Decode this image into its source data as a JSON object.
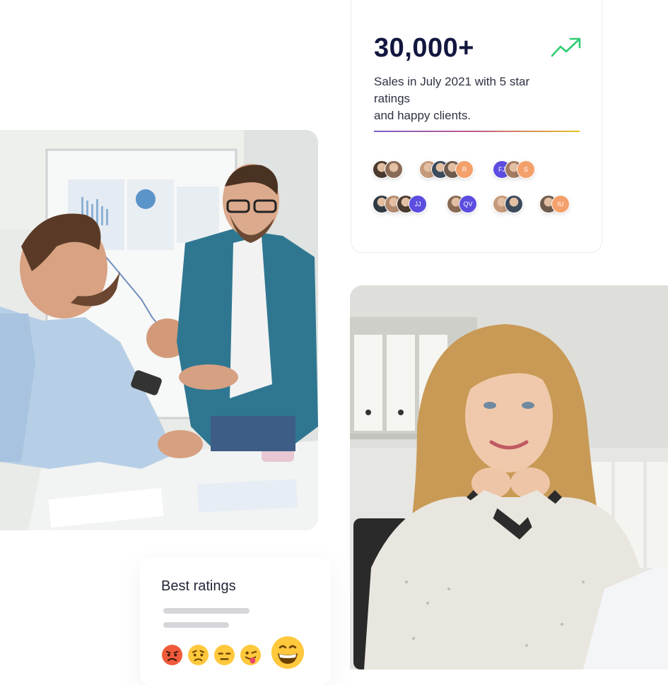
{
  "stats": {
    "value": "30,000+",
    "description_lines": [
      "Sales in July 2021 with 5 star",
      "ratings",
      "and happy clients."
    ],
    "trend_icon": "trending-up-icon",
    "accent_color": "#2ecc71"
  },
  "avatar_groups": [
    {
      "avatars": [
        {
          "type": "photo"
        },
        {
          "type": "photo"
        }
      ]
    },
    {
      "avatars": [
        {
          "type": "photo"
        },
        {
          "type": "photo"
        },
        {
          "type": "photo"
        },
        {
          "type": "initials",
          "text": "R",
          "color": "#f4a06b"
        }
      ]
    },
    {
      "avatars": [
        {
          "type": "initials",
          "text": "FJ",
          "color": "#5c4de0"
        },
        {
          "type": "photo"
        },
        {
          "type": "initials",
          "text": "S",
          "color": "#f4a06b"
        }
      ]
    },
    {
      "avatars": [
        {
          "type": "photo"
        },
        {
          "type": "photo"
        },
        {
          "type": "photo"
        },
        {
          "type": "initials",
          "text": "JJ",
          "color": "#5c4de0"
        }
      ]
    },
    {
      "avatars": [
        {
          "type": "photo"
        },
        {
          "type": "initials",
          "text": "QV",
          "color": "#5c4de0"
        }
      ]
    },
    {
      "avatars": [
        {
          "type": "photo"
        },
        {
          "type": "photo"
        }
      ]
    },
    {
      "avatars": [
        {
          "type": "photo"
        },
        {
          "type": "initials",
          "text": "IU",
          "color": "#f4a06b"
        }
      ]
    }
  ],
  "photos": {
    "team": {
      "subject": "two men talking at office desk"
    },
    "woman": {
      "subject": "smiling woman resting chin on hands"
    }
  },
  "ratings": {
    "title": "Best ratings",
    "emojis": [
      {
        "name": "angry-face-emoji"
      },
      {
        "name": "worried-face-emoji"
      },
      {
        "name": "expressionless-face-emoji"
      },
      {
        "name": "winking-tongue-face-emoji"
      },
      {
        "name": "grinning-face-emoji",
        "selected": true
      }
    ]
  }
}
